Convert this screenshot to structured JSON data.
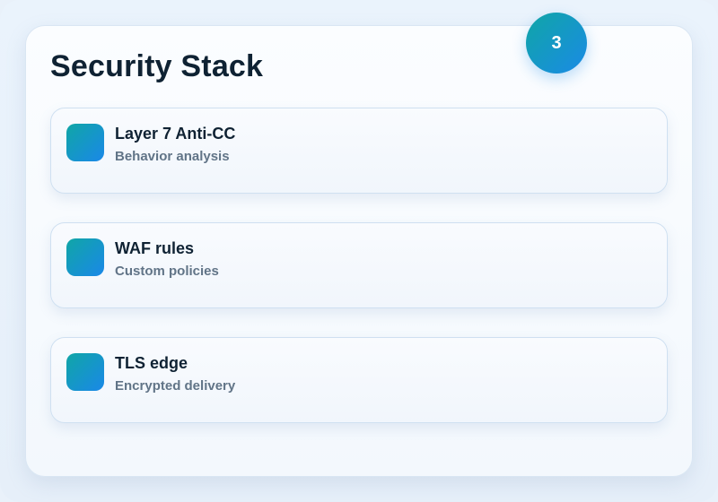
{
  "panel": {
    "title": "Security Stack",
    "badge_count": "3"
  },
  "items": [
    {
      "title": "Layer 7 Anti-CC",
      "subtitle": "Behavior analysis",
      "icon": "gradient-square-icon"
    },
    {
      "title": "WAF rules",
      "subtitle": "Custom policies",
      "icon": "gradient-square-icon"
    },
    {
      "title": "TLS edge",
      "subtitle": "Encrypted delivery",
      "icon": "gradient-square-icon"
    }
  ],
  "colors": {
    "accent_start": "#10a6a6",
    "accent_end": "#1a8ae6",
    "title_text": "#0f2233",
    "subtitle_text": "#617487"
  }
}
